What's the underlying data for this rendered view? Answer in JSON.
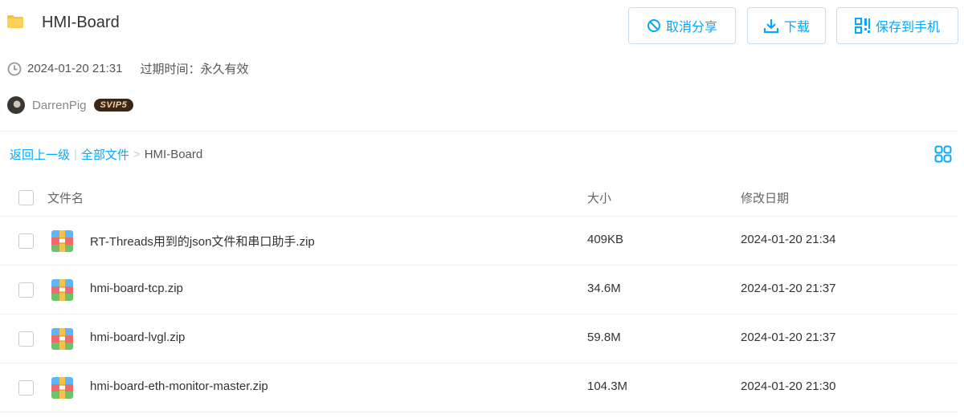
{
  "header": {
    "folder_icon": "folder-icon",
    "title": "HMI-Board",
    "buttons": {
      "cancel_share": "取消分享",
      "download": "下载",
      "save_to_phone": "保存到手机"
    }
  },
  "meta": {
    "share_time": "2024-01-20 21:31",
    "expire_label": "过期时间：",
    "expire_value": "永久有效"
  },
  "user": {
    "name": "DarrenPig",
    "badge": "SVIP5"
  },
  "breadcrumb": {
    "back": "返回上一级",
    "all_files": "全部文件",
    "separator": "|",
    "arrow": ">",
    "current": "HMI-Board"
  },
  "table": {
    "headers": {
      "name": "文件名",
      "size": "大小",
      "date": "修改日期"
    },
    "rows": [
      {
        "name": "RT-Threads用到的json文件和串口助手.zip",
        "size": "409KB",
        "date": "2024-01-20 21:34",
        "icon": "zip-icon"
      },
      {
        "name": "hmi-board-tcp.zip",
        "size": "34.6M",
        "date": "2024-01-20 21:37",
        "icon": "zip-icon"
      },
      {
        "name": "hmi-board-lvgl.zip",
        "size": "59.8M",
        "date": "2024-01-20 21:37",
        "icon": "zip-icon"
      },
      {
        "name": "hmi-board-eth-monitor-master.zip",
        "size": "104.3M",
        "date": "2024-01-20 21:30",
        "icon": "zip-icon"
      }
    ]
  },
  "colors": {
    "accent": "#06a7ff",
    "folder": "#f7c03e",
    "badge_bg": "#3b2718",
    "badge_text": "#f3d3a1"
  }
}
